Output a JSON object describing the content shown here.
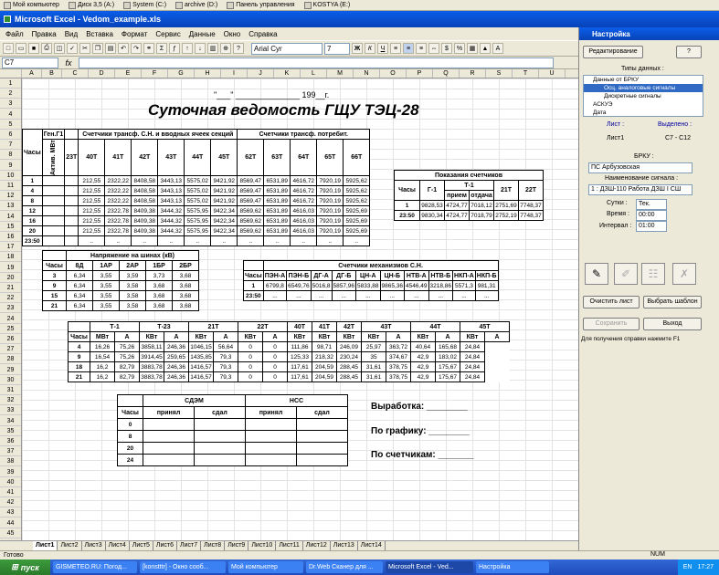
{
  "topbar": {
    "items": [
      "Мой компьютер",
      "Диск 3,5 (A:)",
      "System (C:)",
      "archive (D:)",
      "Панель управления",
      "KOSTYA (E:)"
    ]
  },
  "window": {
    "title": "Microsoft Excel - Vedom_example.xls"
  },
  "menu": [
    "Файл",
    "Правка",
    "Вид",
    "Вставка",
    "Формат",
    "Сервис",
    "Данные",
    "Окно",
    "Справка"
  ],
  "toolbar": {
    "font": "Arial Cyr",
    "size": "7",
    "bold": "Ж",
    "italic": "К",
    "underline": "Ч"
  },
  "formula": {
    "cell": "C7",
    "fx": "fx"
  },
  "columns": [
    "A",
    "B",
    "C",
    "D",
    "E",
    "F",
    "G",
    "H",
    "I",
    "J",
    "K",
    "L",
    "M",
    "N",
    "O",
    "P",
    "Q",
    "R",
    "S",
    "T",
    "U"
  ],
  "rows": [
    "1",
    "2",
    "3",
    "4",
    "5",
    "6",
    "7",
    "8",
    "9",
    "10",
    "11",
    "12",
    "13",
    "14",
    "15",
    "16",
    "17",
    "18",
    "19",
    "20",
    "21",
    "22",
    "23",
    "24",
    "25",
    "26",
    "27",
    "28",
    "29",
    "30",
    "31",
    "32",
    "33",
    "34",
    "35",
    "36",
    "37",
    "38",
    "39",
    "40",
    "41",
    "42",
    "43",
    "44",
    "45"
  ],
  "sheet": {
    "date_line": "\"___\" ______________ 199__г.",
    "main_title": "Суточная ведомость ГЩУ ТЭЦ-28",
    "t1": {
      "gen_header": "Ген.Г1",
      "hours": "Часы",
      "active": "Актив. МВт",
      "sec_header": "Счетчики трансф. С.Н. и вводных ячеек секций",
      "cons_header": "Счетчики трансф. потребит.",
      "cols": [
        "23Т",
        "40Т",
        "41Т",
        "42Т",
        "43Т",
        "44Т",
        "45Т",
        "62Т",
        "63Т",
        "64Т",
        "65Т",
        "66Т"
      ],
      "rows": [
        [
          "1",
          "",
          "",
          "212,55",
          "2322,22",
          "8408,58",
          "3443,13",
          "5575,02",
          "9421,92",
          "8569,47",
          "6531,89",
          "4616,72",
          "7920,19",
          "5925,62"
        ],
        [
          "4",
          "",
          "",
          "212,55",
          "2322,22",
          "8408,58",
          "3443,13",
          "5575,02",
          "9421,92",
          "8569,47",
          "6531,89",
          "4616,72",
          "7920,19",
          "5925,62"
        ],
        [
          "8",
          "",
          "",
          "212,55",
          "2322,22",
          "8408,58",
          "3443,13",
          "5575,02",
          "9421,92",
          "8569,47",
          "6531,89",
          "4616,72",
          "7920,19",
          "5925,62"
        ],
        [
          "12",
          "",
          "",
          "212,55",
          "2322,78",
          "8409,38",
          "3444,32",
          "5575,95",
          "9422,34",
          "8569,62",
          "6531,89",
          "4616,03",
          "7920,19",
          "5925,69"
        ],
        [
          "16",
          "",
          "",
          "212,55",
          "2322,78",
          "8409,38",
          "3444,32",
          "5575,95",
          "9422,34",
          "8569,62",
          "6531,89",
          "4616,03",
          "7920,19",
          "5925,69"
        ],
        [
          "20",
          "",
          "",
          "212,55",
          "2322,78",
          "8409,38",
          "3444,32",
          "5575,95",
          "9422,34",
          "8569,62",
          "6531,89",
          "4616,03",
          "7920,19",
          "5925,69"
        ],
        [
          "23:50",
          "",
          "",
          "..",
          "..",
          "..",
          "..",
          "..",
          "..",
          "..",
          "..",
          "..",
          "..",
          ".."
        ]
      ]
    },
    "t2": {
      "title": "Показания счетчиков",
      "hours": "Часы",
      "cols": [
        "Г-1",
        "Т-1",
        "21Т",
        "22Т"
      ],
      "sub": [
        "прием",
        "отдача"
      ],
      "rows": [
        [
          "1",
          "9828,53",
          "4724,77",
          "7018,12",
          "2751,69",
          "7748,37"
        ],
        [
          "23:50",
          "9830,34",
          "4724,77",
          "7018,79",
          "2752,19",
          "7748,37"
        ]
      ]
    },
    "t3": {
      "title": "Напряжение на шинах (кВ)",
      "hours": "Часы",
      "cols": [
        "8Д",
        "1АР",
        "2АР",
        "1БР",
        "2БР"
      ],
      "rows": [
        [
          "3",
          "6,34",
          "3,55",
          "3,59",
          "3,73",
          "3,68"
        ],
        [
          "9",
          "6,34",
          "3,55",
          "3,58",
          "3,68",
          "3,68"
        ],
        [
          "15",
          "6,34",
          "3,55",
          "3,58",
          "3,68",
          "3,68"
        ],
        [
          "21",
          "6,34",
          "3,55",
          "3,58",
          "3,68",
          "3,68"
        ]
      ]
    },
    "t4": {
      "title": "Счетчики механизмов С.Н.",
      "hours": "Часы",
      "cols": [
        "ПЭН-А",
        "ПЭН-Б",
        "ДГ-А",
        "ДГ-Б",
        "ЦН-А",
        "ЦН-Б",
        "НТВ-А",
        "НТВ-Б",
        "НКП-А",
        "НКП-Б"
      ],
      "rows": [
        [
          "1",
          "6799,8",
          "6549,76",
          "5016,8",
          "5857,96",
          "5833,88",
          "9865,36",
          "4546,49",
          "3218,86",
          "5571,3",
          "981,31"
        ],
        [
          "23:50",
          "...",
          "...",
          "...",
          "...",
          "...",
          "...",
          "...",
          "...",
          "...",
          "..."
        ]
      ]
    },
    "t5": {
      "hours": "Часы",
      "groups": [
        "Т-1",
        "Т-23",
        "21Т",
        "22Т",
        "40Т",
        "41Т",
        "42Т",
        "43Т",
        "44Т",
        "45Т"
      ],
      "sub": [
        "МВт",
        "А",
        "КВт",
        "А",
        "КВт",
        "А",
        "КВт",
        "А",
        "КВт",
        "КВт",
        "КВт",
        "КВт",
        "А",
        "КВт",
        "А",
        "КВт",
        "А"
      ],
      "rows": [
        [
          "4",
          "16,26",
          "75,26",
          "3858,11",
          "246,36",
          "1046,15",
          "56,64",
          "0",
          "0",
          "111,86",
          "98,71",
          "246,09",
          "25,97",
          "363,72",
          "40,64",
          "165,68",
          "24,84"
        ],
        [
          "9",
          "16,54",
          "75,26",
          "3914,45",
          "259,65",
          "1435,85",
          "79,3",
          "0",
          "0",
          "125,33",
          "218,32",
          "230,24",
          "35",
          "374,67",
          "42,9",
          "183,02",
          "24,84"
        ],
        [
          "18",
          "16,2",
          "82,79",
          "3883,78",
          "246,36",
          "1416,57",
          "79,3",
          "0",
          "0",
          "117,61",
          "204,59",
          "288,45",
          "31,61",
          "378,75",
          "42,9",
          "175,67",
          "24,84"
        ],
        [
          "21",
          "16,2",
          "82,79",
          "3883,78",
          "246,36",
          "1416,57",
          "79,3",
          "0",
          "0",
          "117,61",
          "204,59",
          "288,45",
          "31,61",
          "378,75",
          "42,9",
          "175,67",
          "24,84"
        ]
      ]
    },
    "t6": {
      "hours": "Часы",
      "groups": [
        "СДЭМ",
        "НСС"
      ],
      "sub": [
        "принял",
        "сдал",
        "принял",
        "сдал"
      ],
      "rows": [
        "0",
        "8",
        "20",
        "24"
      ]
    },
    "out_label": "Выработка: ________",
    "plan_label": "По графику: ________",
    "meter_label": "По счетчикам: _______"
  },
  "sheet_tabs": [
    "Лист1",
    "Лист2",
    "Лист3",
    "Лист4",
    "Лист5",
    "Лист6",
    "Лист7",
    "Лист8",
    "Лист9",
    "Лист10",
    "Лист11",
    "Лист12",
    "Лист13",
    "Лист14"
  ],
  "status": {
    "left": "Готово",
    "num": "NUM"
  },
  "taskbar": {
    "start": "пуск",
    "tasks": [
      "GISMETEO.RU: Погод...",
      "[konstttr] - Окно сооб...",
      "Мой компьютер",
      "Dr.Web Сканер для ...",
      "Microsoft Excel - Ved...",
      "Настройка"
    ],
    "lang": "EN",
    "clock": "17:27"
  },
  "panel": {
    "title": "Настройка",
    "edit_btn": "Редактирование",
    "help_btn": "?",
    "types_label": "Типы данных :",
    "tree": [
      "Данные от БРКУ",
      "Осц. аналоговые сигналы",
      "Дискретные сигналы",
      "АСКУЭ",
      "Дата"
    ],
    "sheet_label": "Лист :",
    "selected_label": "Выделено :",
    "sheet_val": "Лист1",
    "selected_val": "C7 - C12",
    "brku_label": "БРКУ :",
    "brku_val": "ПС Арбузовская",
    "signal_label": "Наименование сигнала :",
    "signal_val": "1 : ДЗШ-110 Работа ДЗШ I СШ",
    "day_label": "Сутки :",
    "day_val": "Тек.",
    "time_label": "Время :",
    "time_val": "00:00",
    "interval_label": "Интервал :",
    "interval_val": "01:00",
    "clear_btn": "Очистить лист",
    "template_btn": "Выбрать шаблон",
    "save_btn": "Сохранить",
    "exit_btn": "Выход",
    "hint": "Для получения справки нажмите F1"
  }
}
